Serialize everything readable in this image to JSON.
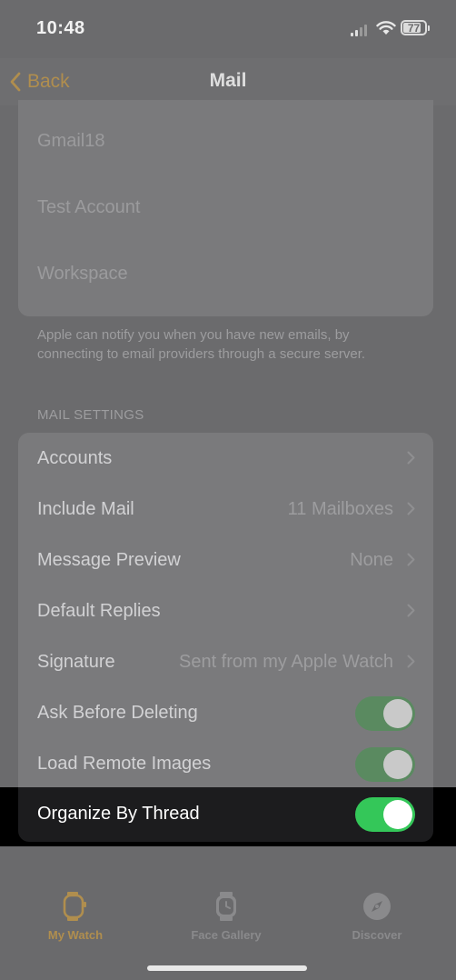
{
  "status_bar": {
    "time": "10:48",
    "battery": "77"
  },
  "nav": {
    "back_label": "Back",
    "title": "Mail"
  },
  "accounts": [
    "Gmail18",
    "Test Account",
    "Workspace"
  ],
  "accounts_footer": "Apple can notify you when you have new emails, by connecting to email providers through a secure server.",
  "section_header": "MAIL SETTINGS",
  "settings": {
    "accounts": {
      "label": "Accounts"
    },
    "include_mail": {
      "label": "Include Mail",
      "value": "11 Mailboxes"
    },
    "message_preview": {
      "label": "Message Preview",
      "value": "None"
    },
    "default_replies": {
      "label": "Default Replies"
    },
    "signature": {
      "label": "Signature",
      "value": "Sent from my Apple Watch"
    },
    "ask_before_deleting": {
      "label": "Ask Before Deleting",
      "on": true
    },
    "load_remote_images": {
      "label": "Load Remote Images",
      "on": true
    },
    "organize_by_thread": {
      "label": "Organize By Thread",
      "on": true
    }
  },
  "tabs": {
    "my_watch": "My Watch",
    "face_gallery": "Face Gallery",
    "discover": "Discover"
  },
  "colors": {
    "accent": "#b08e4e",
    "toggle_on": "#34c759"
  }
}
